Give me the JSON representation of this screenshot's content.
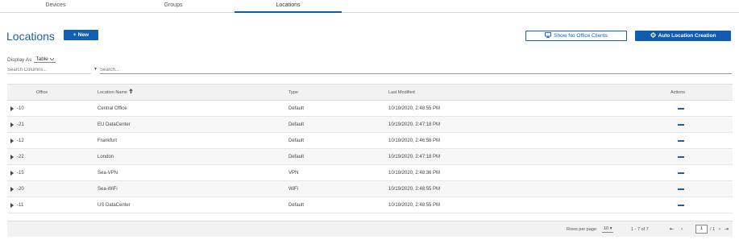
{
  "tabs": [
    {
      "label": "Devices"
    },
    {
      "label": "Groups"
    },
    {
      "label": "Locations"
    }
  ],
  "page_title": "Locations",
  "new_button": {
    "icon": "+",
    "label": "New"
  },
  "show_no_office_button": {
    "label": "Show No Office Clients"
  },
  "auto_location_button": {
    "label": "Auto Location Creation"
  },
  "display_as": {
    "label": "Display As",
    "value": "Table"
  },
  "search": {
    "columns_placeholder": "Search Columns...",
    "main_placeholder": "Search..."
  },
  "table": {
    "headers": {
      "office": "Office",
      "location_name": "Location Name",
      "type": "Type",
      "last_modified": "Last Modified",
      "actions": "Actions"
    },
    "rows": [
      {
        "office": "-10",
        "name": "Central Office",
        "type": "Default",
        "modified": "10/19/2020, 2:48:55 PM"
      },
      {
        "office": "-21",
        "name": "EU DataCenter",
        "type": "Default",
        "modified": "10/19/2020, 2:47:18 PM"
      },
      {
        "office": "-12",
        "name": "Frankfurt",
        "type": "Default",
        "modified": "10/19/2020, 2:46:58 PM"
      },
      {
        "office": "-22",
        "name": "London",
        "type": "Default",
        "modified": "10/19/2020, 2:47:18 PM"
      },
      {
        "office": "-15",
        "name": "Sea-VPN",
        "type": "VPN",
        "modified": "10/19/2020, 2:48:36 PM"
      },
      {
        "office": "-20",
        "name": "Sea-WiFi",
        "type": "WiFi",
        "modified": "10/19/2020, 2:48:55 PM"
      },
      {
        "office": "-11",
        "name": "US DataCenter",
        "type": "Default",
        "modified": "10/19/2020, 2:48:55 PM"
      }
    ]
  },
  "footer": {
    "rows_per_page_label": "Rows per page:",
    "rows_per_page_value": "10",
    "range": "1 - 7 of 7",
    "page": "1",
    "page_total": "/ 1"
  },
  "colors": {
    "accent": "#1160b5",
    "title": "#1a5fa8"
  }
}
